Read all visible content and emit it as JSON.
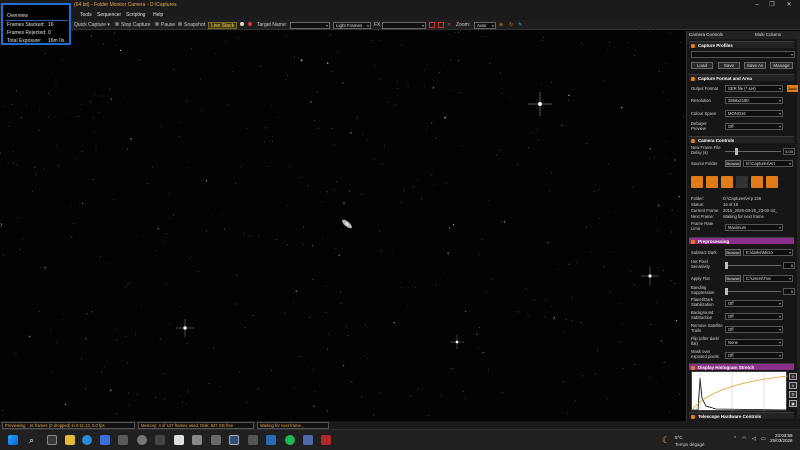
{
  "window": {
    "title": "(64 bit) - Folder Monitor Camera - D:\\Captures",
    "buttons": [
      "–",
      "❐",
      "✕"
    ]
  },
  "menu": {
    "items": [
      "Tools",
      "Sequencer",
      "Scripting",
      "Help"
    ]
  },
  "toolbar": {
    "quick_capture": "Quick Capture",
    "stop_capture": "Stop Capture",
    "pause": "Pause",
    "snapshot": "Snapshot",
    "live_stack": "Live Stack",
    "target_name_label": "Target Name:",
    "target_name_value": "",
    "frame_type": "Light Frames",
    "fx_label": "FX",
    "fx_value": "",
    "zoom_label": "Zoom:",
    "zoom_value": "Auto"
  },
  "overview": {
    "title": "Overview",
    "rows": [
      {
        "label": "Frames Stacked:",
        "value": "16"
      },
      {
        "label": "Frames Rejected:",
        "value": "0"
      },
      {
        "label": "Total Exposure:",
        "value": "16m 0s"
      }
    ]
  },
  "panel": {
    "tabs": [
      "Camera Controls",
      "Multi Column"
    ],
    "capture_profiles": {
      "title": "Capture Profiles",
      "buttons": [
        "Load",
        "Save",
        "Save As",
        "Manage"
      ]
    },
    "capture_format": {
      "title": "Capture Format and Area",
      "output_format_label": "Output Format",
      "output_format_value": "SER file (*.ser)",
      "auto_label": "Auto",
      "resolution_label": "Resolution",
      "resolution_value": "3856x2180",
      "colour_space_label": "Colour Space",
      "colour_space_value": "MONO16",
      "debayer_label": "Debayer Preview",
      "debayer_value": "Off"
    },
    "camera_controls": {
      "title": "Camera Controls",
      "new_frame_label": "New Frame File Delay (s)",
      "new_frame_value": "5.00",
      "source_folder_label": "Source Folder",
      "browse_label": "Browse",
      "source_folder_value": "D:\\Captures\\Art",
      "folder_label": "Folder:",
      "folder_value": "D:\\Captures\\Arp 336",
      "status_label": "Status:",
      "status_value": "16 of 16",
      "current_frame_label": "Current Frame:",
      "current_frame_value": "2015_2026-03-25_23-02-44_",
      "next_frame_label": "Next Frame:",
      "next_frame_value": "Waiting for next frame",
      "frame_rate_label": "Frame Rate Limit",
      "frame_rate_value": "Maximum"
    },
    "preprocessing": {
      "title": "Preprocessing",
      "subtract_dark_label": "Subtract Dark",
      "subtract_dark_browse": "Browse",
      "subtract_dark_value": "E:\\darks\\Micro",
      "hot_pixel_label": "Hot Pixel Sensitivity",
      "hot_pixel_value": "0",
      "apply_flat_label": "Apply Flat",
      "apply_flat_browse": "Browse",
      "apply_flat_value": "C:\\Users\\Trai",
      "banding_label": "Banding Suppression",
      "banding_value": "0",
      "planet_label": "Planet/Dark Stabilization",
      "planet_value": "Off",
      "background_label": "Background Subtraction",
      "background_value": "Off",
      "remove_sat_label": "Remove Satellite Trails",
      "remove_sat_value": "Off",
      "flip_label": "Flip (after dark/ flat)",
      "flip_value": "None",
      "mask_label": "Mask over exposed pixels",
      "mask_value": "Off"
    },
    "histogram": {
      "title": "Display Histogram Stretch"
    },
    "telescope": {
      "title": "Telescope Hardware Controls"
    }
  },
  "statusbar": {
    "previewing": "Previewing : 16 frames (0 dropped) in 0:11:13, 0.0 fps",
    "memory": "Memory: 4 of 127 frames used, Disk: 847 GB free",
    "waiting": "Waiting for next frame..."
  },
  "taskbar": {
    "weather_temp": "5°C",
    "weather_desc": "Temps dégagé",
    "time": "23:03:59",
    "date": "25/03/2026"
  }
}
